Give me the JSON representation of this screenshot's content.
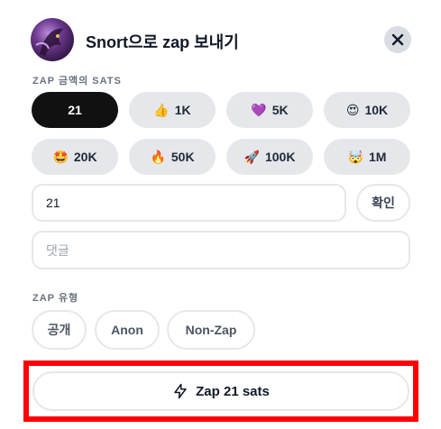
{
  "header": {
    "title": "Snort으로 zap 보내기"
  },
  "amount_section": {
    "label": "ZAP 금액의 SATS",
    "options": [
      {
        "emoji": "",
        "label": "21",
        "selected": true
      },
      {
        "emoji": "👍",
        "label": "1K"
      },
      {
        "emoji": "💜",
        "label": "5K"
      },
      {
        "emoji": "😍",
        "label": "10K"
      },
      {
        "emoji": "🤩",
        "label": "20K"
      },
      {
        "emoji": "🔥",
        "label": "50K"
      },
      {
        "emoji": "🚀",
        "label": "100K"
      },
      {
        "emoji": "🤯",
        "label": "1M"
      }
    ]
  },
  "amount_input": {
    "value": "21"
  },
  "confirm_label": "확인",
  "comment_input": {
    "placeholder": "댓글"
  },
  "type_section": {
    "label": "ZAP 유형",
    "options": [
      "공개",
      "Anon",
      "Non-Zap"
    ]
  },
  "zap_button": {
    "label": "Zap 21 sats"
  },
  "colors": {
    "highlight": "#ff0000",
    "selected_bg": "#111111",
    "pill_bg": "#e5e7eb"
  }
}
